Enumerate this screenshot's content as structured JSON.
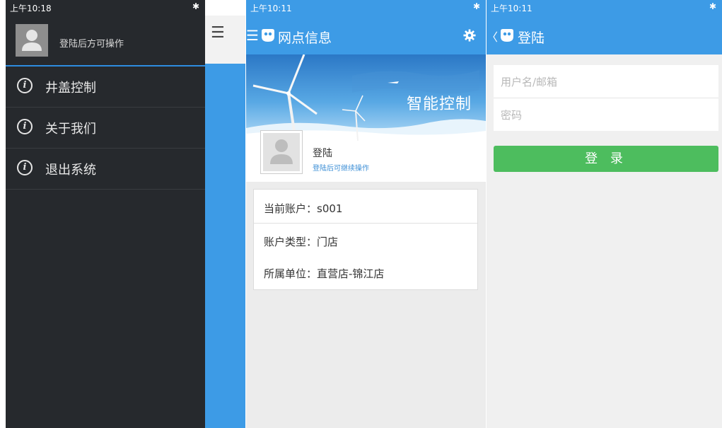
{
  "screen1": {
    "status_time": "上午10:18",
    "status_icons": "✱ ",
    "profile_label": "登陆后方可操作",
    "menu": [
      {
        "icon": "info-icon",
        "label": "井盖控制"
      },
      {
        "icon": "info-icon",
        "label": "关于我们"
      },
      {
        "icon": "info-icon",
        "label": "退出系统"
      }
    ],
    "background_menu_glyph": "☰"
  },
  "screen2": {
    "status_time": "上午10:11",
    "status_icons": "✱ ",
    "title": "网点信息",
    "banner_text": "智能控制",
    "login_title": "登陆",
    "login_subtitle": "登陆后可继续操作",
    "info_rows": [
      "当前账户：s001",
      "账户类型：门店",
      "所属单位：直营店-锦江店"
    ],
    "menu_glyph": "☰"
  },
  "screen3": {
    "status_time": "上午10:11",
    "status_icons": "✱ ",
    "title": "登陆",
    "back_glyph": "〈",
    "username_placeholder": "用户名/邮箱",
    "password_placeholder": "密码",
    "login_button": "登 录"
  },
  "colors": {
    "header_blue": "#3d9be6",
    "drawer_dark": "#26292d",
    "button_green": "#4dbd5e"
  }
}
